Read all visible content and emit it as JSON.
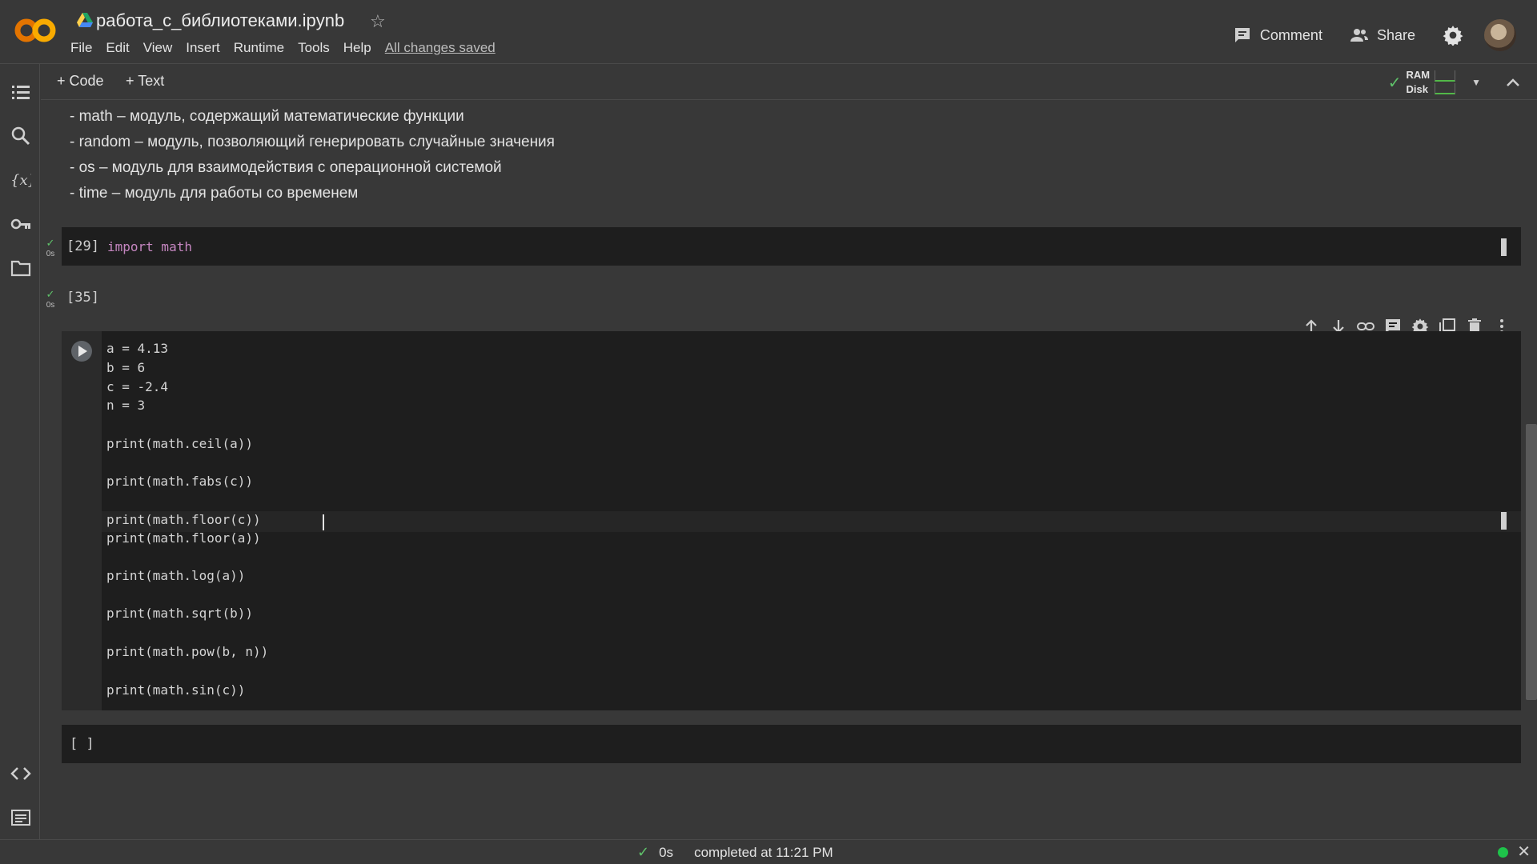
{
  "header": {
    "file_title": "работа_с_библиотеками.ipynb",
    "menu": [
      "File",
      "Edit",
      "View",
      "Insert",
      "Runtime",
      "Tools",
      "Help"
    ],
    "saved_status": "All changes saved",
    "comment_label": "Comment",
    "share_label": "Share"
  },
  "toolbar": {
    "add_code": "+ Code",
    "add_text": "+ Text",
    "ram_label": "RAM",
    "disk_label": "Disk"
  },
  "markdown": {
    "lines": [
      "- math – модуль, содержащий математические функции",
      "- random – модуль, позволяющий генерировать случайные значения",
      "- os – модуль для взаимодействия с операционной системой",
      "- time – модуль для работы со временем"
    ]
  },
  "cells": [
    {
      "exec": "[29]",
      "duration": "0s",
      "code": "import math"
    },
    {
      "exec": "[35]",
      "duration": "0s"
    }
  ],
  "main_cell": {
    "lines": [
      "a = 4.13",
      "b = 6",
      "c = -2.4",
      "n = 3",
      "print(math.ceil(a))",
      "print(math.fabs(c))",
      "print(math.floor(c))",
      "print(math.floor(a))",
      "print(math.log(a))",
      "print(math.sqrt(b))",
      "print(math.pow(b, n))",
      "print(math.sin(c))"
    ]
  },
  "empty_cell": {
    "exec": "[ ]"
  },
  "status_bar": {
    "duration": "0s",
    "completed": "completed at 11:21 PM"
  },
  "colors": {
    "accent_green": "#5fc26a",
    "logo_orange": "#f9ab00",
    "logo_dark_orange": "#e37400"
  }
}
